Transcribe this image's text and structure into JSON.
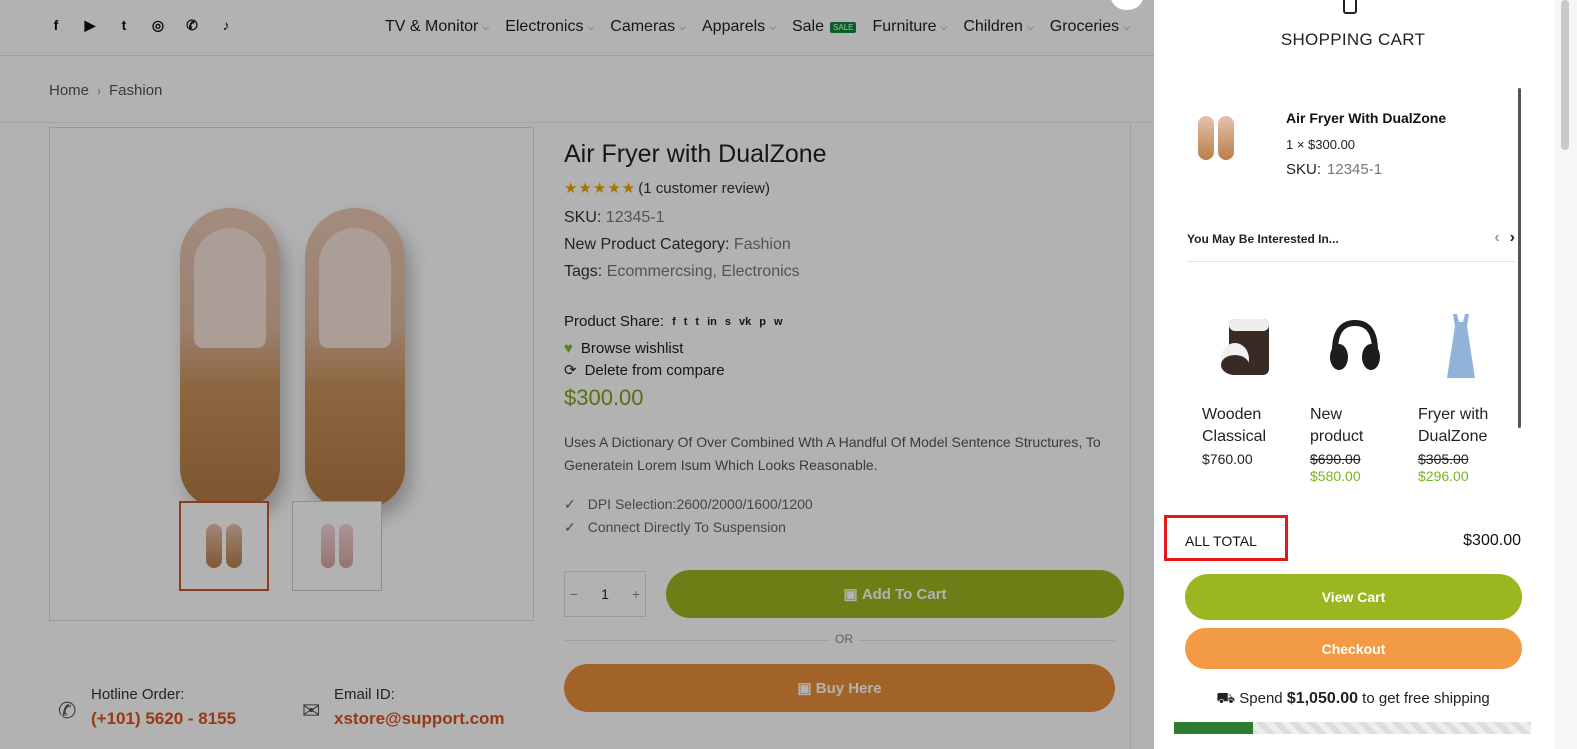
{
  "header": {
    "socials": [
      "facebook-icon",
      "youtube-icon",
      "twitter-icon",
      "instagram-icon",
      "whatsapp-icon",
      "tiktok-icon"
    ],
    "social_glyphs": [
      "f",
      "▶",
      "t",
      "◎",
      "✆",
      "♪"
    ],
    "nav": [
      "TV & Monitor",
      "Electronics",
      "Cameras",
      "Apparels",
      "Sale",
      "Furniture",
      "Children",
      "Groceries"
    ],
    "sale_badge": "SALE"
  },
  "breadcrumb": {
    "home": "Home",
    "current": "Fashion"
  },
  "product": {
    "title": "Air Fryer with DualZone",
    "stars": "★★★★★",
    "review": "(1 customer review)",
    "sku_label": "SKU:",
    "sku": "12345-1",
    "category_label": "New Product Category:",
    "category": "Fashion",
    "tags_label": "Tags:",
    "tags": "Ecommercsing, Electronics",
    "share_label": "Product Share:",
    "share_icons": [
      "f",
      "t",
      "t",
      "in",
      "s",
      "vk",
      "p",
      "w"
    ],
    "wishlist": "Browse wishlist",
    "compare": "Delete from compare",
    "price": "$300.00",
    "description": "Uses A Dictionary Of Over Combined Wth A Handful Of Model Sentence Structures, To Generatein Lorem Isum Which Looks Reasonable.",
    "features": [
      "DPI Selection:2600/2000/1600/1200",
      "Connect Directly To Suspension"
    ],
    "qty": "1",
    "add_to_cart": "Add To Cart",
    "or": "OR",
    "buy_here": "Buy Here",
    "hotline_label": "Hotline Order:",
    "hotline": "(+101) 5620 - 8155",
    "email_label": "Email ID:",
    "email": "xstore@support.com"
  },
  "cart": {
    "title": "SHOPPING CART",
    "item": {
      "name": "Air Fryer With DualZone",
      "qty_price": "1 × $300.00",
      "sku_label": "SKU:",
      "sku": "12345-1"
    },
    "interested_title": "You May Be Interested In...",
    "recommendations": [
      {
        "name": "Wooden Classical",
        "price": "$760.00",
        "old_price": "",
        "new_price": ""
      },
      {
        "name": "New product",
        "price": "",
        "old_price": "$690.00",
        "new_price": "$580.00"
      },
      {
        "name": "Fryer with DualZone",
        "price": "",
        "old_price": "$305.00",
        "new_price": "$296.00"
      }
    ],
    "total_label": "ALL TOTAL",
    "total": "$300.00",
    "view_cart": "View Cart",
    "checkout": "Checkout",
    "ship_prefix": "Spend",
    "ship_amount": "$1,050.00",
    "ship_suffix": "to get free shipping",
    "ship_progress": 0.22
  },
  "colors": {
    "green": "#9ab620",
    "orange": "#f39a45",
    "highlight": "#e01919",
    "progress": "#2e7d32"
  }
}
